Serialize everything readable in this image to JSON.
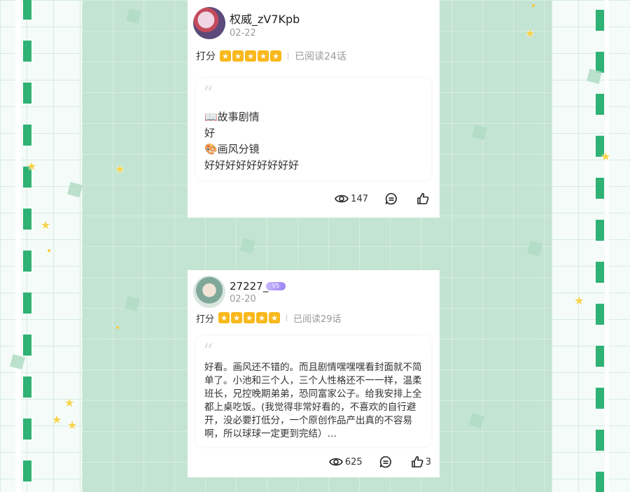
{
  "reviews": [
    {
      "username": "权威_zV7Kpb",
      "date": "02-22",
      "rating_label": "打分",
      "rating_stars": 5,
      "read_info": "已阅读24话",
      "lines": [
        "📖故事剧情",
        "好",
        "🎨画风分镜",
        "好好好好好好好好好"
      ],
      "views": "147",
      "comments": "",
      "likes": ""
    },
    {
      "username": "27227_",
      "badge": "V5",
      "date": "02-20",
      "rating_label": "打分",
      "rating_stars": 5,
      "read_info": "已阅读29话",
      "text": "好看。画风还不错的。而且剧情嘿嘿嘿看封面就不简单了。小池和三个人，三个人性格还不一一样，温柔班长，兄控晚期弟弟，恐同富家公子。给我安排上全都上桌吃饭。(我觉得非常好看的，不喜欢的自行避开，没必要打低分，一个原创作品产出真的不容易啊，所以球球一定更到完结）…",
      "views": "625",
      "comments": "",
      "likes": "3"
    }
  ],
  "icons": {
    "views": "eye-icon",
    "comments": "comment-icon",
    "likes": "thumbs-up-icon"
  },
  "colors": {
    "accent_green": "#2fb274",
    "star_yellow": "#f9b81b",
    "panel_green": "#c3e4d2"
  }
}
